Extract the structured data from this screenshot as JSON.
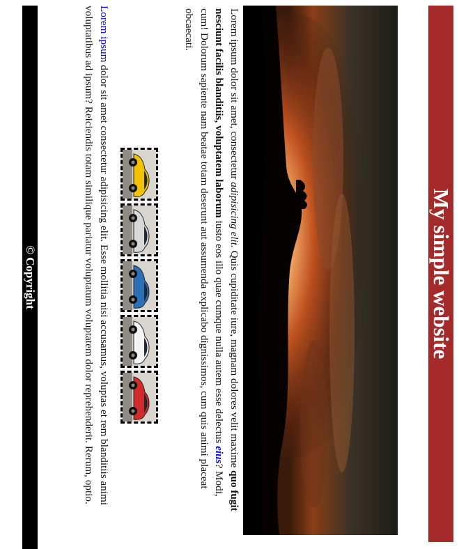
{
  "header": {
    "title": "My simple website"
  },
  "paragraph1": {
    "text_a": "Lorem ipsum dolor sit amet, consectetur ",
    "italic_a": "adipisicing elit.",
    "text_b": " Quis cupiditate iure, magnam dolores velit maxime ",
    "bold_a": "quo fugit nesciunt facilis blanditiis, voluptatem laborum",
    "text_c": " iusto eos illo quae cumque nulla autem esse delectus ",
    "link_a": "eius",
    "text_d": "? Modi, cum! Dolorum sapiente nam beatae totam deserunt aut assumenda explicabo dignissimos, cum quis animi placeat obcaecati."
  },
  "gallery": {
    "thumbs": [
      {
        "name": "yellow-car-thumb",
        "color": "#f2c200"
      },
      {
        "name": "silver-car-thumb",
        "color": "#d8d8d8"
      },
      {
        "name": "blue-car-thumb",
        "color": "#2d6fb7"
      },
      {
        "name": "white-car-thumb",
        "color": "#f4f4f4"
      },
      {
        "name": "red-car-thumb",
        "color": "#d32b2b"
      }
    ]
  },
  "paragraph2": {
    "link_a": "Lorem ipsum",
    "text_a": " dolor sit amet consectetur adipisicing elit. Esse mollitia nisi accusamus, voluptas et rem blanditiis animi voluptatibus ad ipsum? Reiciendis totam similique pariatur voluptatum voluptatem dolor reprehenderit. Rerum, optio."
  },
  "footer": {
    "copyright": "© Copyright"
  },
  "colors": {
    "header_bg": "#a52a2a",
    "footer_bg": "#000000",
    "link": "#0000ee"
  }
}
